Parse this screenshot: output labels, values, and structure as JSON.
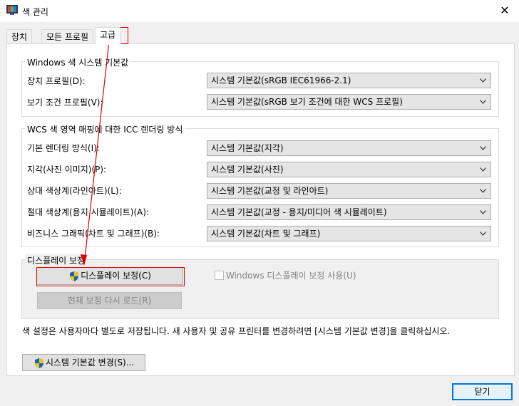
{
  "window": {
    "title": "색 관리"
  },
  "tabs": [
    {
      "label": "장치"
    },
    {
      "label": "모든 프로필"
    },
    {
      "label": "고급"
    }
  ],
  "windows_defaults": {
    "legend": "Windows 색 시스템 기본값",
    "rows": [
      {
        "label": "장치 프로필(D):",
        "value": "시스템 기본값(sRGB IEC61966-2.1)"
      },
      {
        "label": "보기 조건 프로필(V):",
        "value": "시스템 기본값(sRGB 보기 조건에 대한 WCS 프로필)"
      }
    ]
  },
  "icc_mapping": {
    "legend": "WCS 색 영역 매핑에 대한 ICC 렌더링 방식",
    "rows": [
      {
        "label": "기본 렌더링 방식(I):",
        "value": "시스템 기본값(지각)"
      },
      {
        "label": "지각(사진 이미지)(P):",
        "value": "시스템 기본값(사진)"
      },
      {
        "label": "상대 색상계(라인아트)(L):",
        "value": "시스템 기본값(교정 및 라인아트)"
      },
      {
        "label": "절대 색상계(용지 시뮬레이트)(A):",
        "value": "시스템 기본값(교정 - 용지/미디어 색 시뮬레이트)"
      },
      {
        "label": "비즈니스 그래픽(차트 및 그래프)(B):",
        "value": "시스템 기본값(차트 및 그래프)"
      }
    ]
  },
  "display_calibration": {
    "legend": "디스플레이 보정",
    "calibrate_button": "디스플레이 보정(C)",
    "reload_button": "현재 보정 다시 로드(R)",
    "use_calibration_checkbox": "Windows 디스플레이 보정 사용(U)",
    "use_calibration_checked": false
  },
  "note": "색 설정은 사용자마다 별도로 저장됩니다. 새 사용자 및 공유 프린터를 변경하려면 [시스템 기본값 변경]을 클릭하십시오.",
  "change_defaults_button": "시스템 기본값 변경(S)...",
  "close_button": "닫기",
  "colors": {
    "annotation_red": "#e00000",
    "focus_blue": "#0078d7"
  }
}
